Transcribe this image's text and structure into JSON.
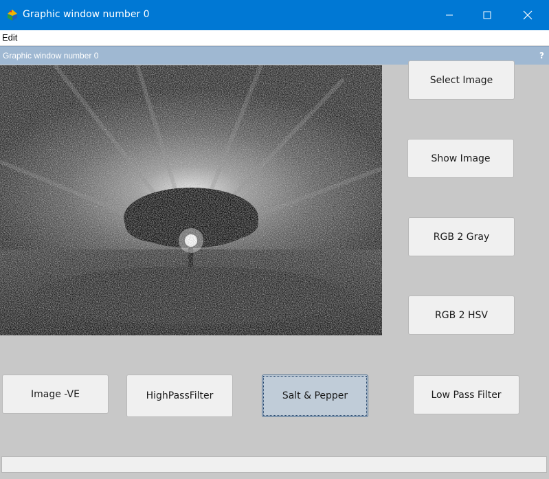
{
  "window": {
    "title": "Graphic window number 0",
    "icons": {
      "app": "scilab-icon",
      "minimize": "minimize-icon",
      "maximize": "maximize-icon",
      "close": "close-icon"
    }
  },
  "menubar": {
    "items": [
      {
        "label": "Edit"
      }
    ]
  },
  "figure": {
    "header": "Graphic window number 0",
    "help_label": "?"
  },
  "buttons": {
    "select_image": "Select Image",
    "show_image": "Show Image",
    "rgb2gray": "RGB 2 Gray",
    "rgb2hsv": "RGB 2 HSV",
    "image_ve": "Image -VE",
    "highpass": "HighPassFilter",
    "salt_pepper": "Salt & Pepper",
    "lowpass": "Low Pass Filter"
  },
  "colors": {
    "titlebar": "#0078d4",
    "figure_bg": "#c8c8c8",
    "header_bg": "#9fb8d2",
    "active_button": "#c0ccd8"
  },
  "image": {
    "description": "noisy-grayscale-tree-sunset"
  },
  "statusbar": {
    "text": ""
  }
}
